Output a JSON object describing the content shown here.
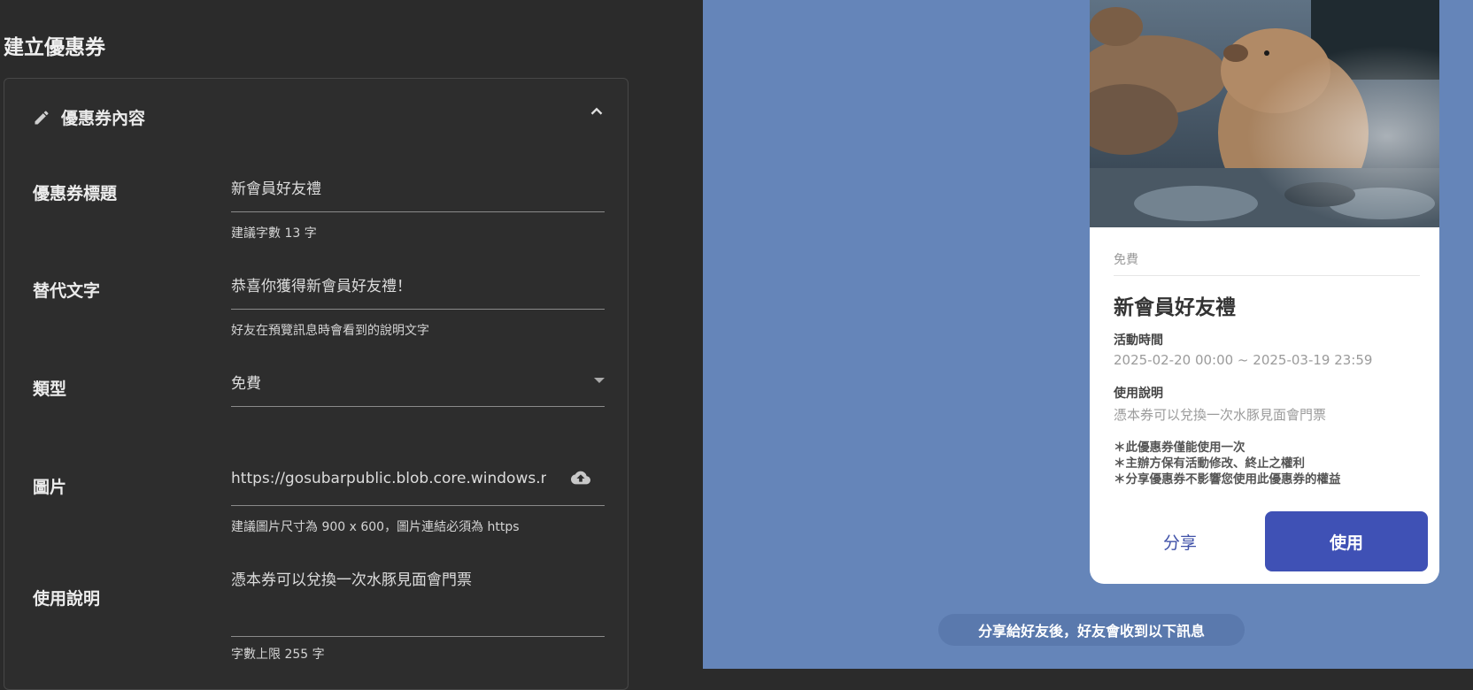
{
  "page": {
    "title": "建立優惠券"
  },
  "section": {
    "title": "優惠券內容"
  },
  "fields": {
    "title": {
      "label": "優惠券標題",
      "value": "新會員好友禮",
      "hint": "建議字數 13 字"
    },
    "alt": {
      "label": "替代文字",
      "value": "恭喜你獲得新會員好友禮！",
      "hint": "好友在預覽訊息時會看到的說明文字"
    },
    "type": {
      "label": "類型",
      "value": "免費"
    },
    "image": {
      "label": "圖片",
      "value": "https://gosubarpublic.blob.core.windows.net",
      "hint": "建議圖片尺寸為 900 x 600，圖片連結必須為 https"
    },
    "usage": {
      "label": "使用說明",
      "value": "憑本券可以兌換一次水豚見面會門票",
      "hint": "字數上限 255 字"
    }
  },
  "coupon": {
    "type": "免費",
    "title": "新會員好友禮",
    "period_label": "活動時間",
    "period_value": "2025-02-20 00:00 ~ 2025-03-19 23:59",
    "usage_label": "使用說明",
    "usage_value": "憑本券可以兌換一次水豚見面會門票",
    "notes": [
      "＊此優惠券僅能使用一次",
      "＊主辦方保有活動修改、終止之權利",
      "＊分享優惠券不影響您使用此優惠券的權益"
    ],
    "share_label": "分享",
    "use_label": "使用"
  },
  "share_hint": "分享給好友後，好友會收到以下訊息",
  "colors": {
    "accent": "#3f51b5",
    "preview_bg": "#6585b9",
    "editor_bg": "#2b2b2b"
  },
  "icons": {
    "edit": "pencil-icon",
    "collapse": "chevron-up-icon",
    "dropdown": "caret-down-icon",
    "upload": "cloud-upload-icon"
  }
}
